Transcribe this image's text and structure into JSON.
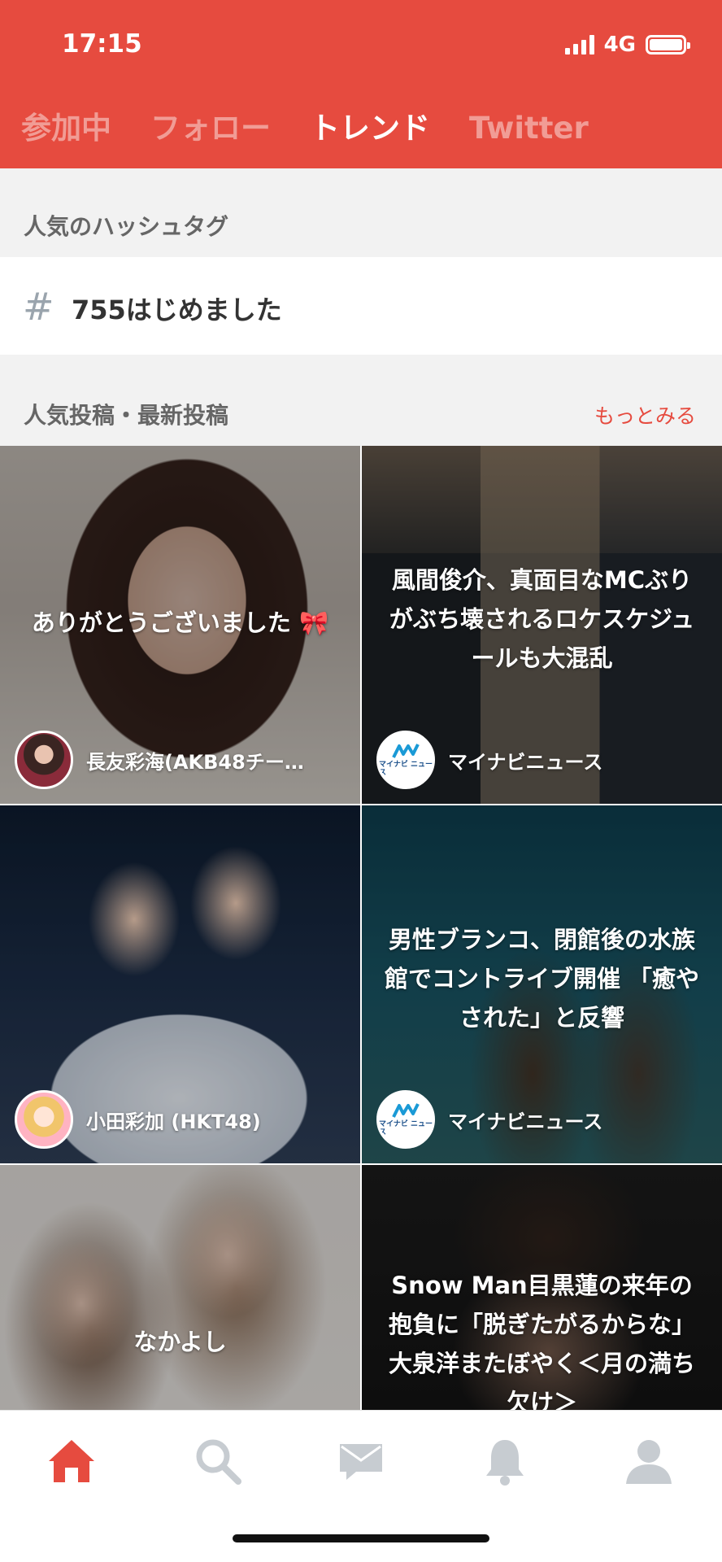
{
  "status_bar": {
    "time": "17:15",
    "network": "4G"
  },
  "tabs": [
    {
      "label": "参加中",
      "active": false
    },
    {
      "label": "フォロー",
      "active": false
    },
    {
      "label": "トレンド",
      "active": true
    },
    {
      "label": "Twitter",
      "active": false
    }
  ],
  "hashtags": {
    "title": "人気のハッシュタグ",
    "items": [
      {
        "icon": "hash-icon",
        "label": "755はじめました"
      }
    ]
  },
  "posts": {
    "title": "人気投稿・最新投稿",
    "more_label": "もっとみる",
    "cards": [
      {
        "text": "ありがとうございました 🎀",
        "source": "長友彩海(AKB48チー…",
        "avatar": "member-avatar"
      },
      {
        "text": "風間俊介、真面目なMCぶりがぶち壊されるロケスケジュールも大混乱",
        "source": "マイナビニュース",
        "avatar": "mynavi-logo"
      },
      {
        "text": "",
        "source": "小田彩加 (HKT48)",
        "avatar": "member-avatar"
      },
      {
        "text": "男性ブランコ、閉館後の水族館でコントライブ開催 「癒やされた」と反響",
        "source": "マイナビニュース",
        "avatar": "mynavi-logo"
      },
      {
        "text": "なかよし",
        "source": "",
        "avatar": ""
      },
      {
        "text": "Snow Man目黒蓮の来年の抱負に「脱ぎたがるからな」大泉洋またぼやく＜月の満ち欠け＞",
        "source": "",
        "avatar": ""
      }
    ]
  },
  "bottom_nav": [
    {
      "icon": "home-icon",
      "active": true
    },
    {
      "icon": "search-icon",
      "active": false
    },
    {
      "icon": "mail-icon",
      "active": false
    },
    {
      "icon": "bell-icon",
      "active": false
    },
    {
      "icon": "profile-icon",
      "active": false
    }
  ],
  "colors": {
    "accent": "#e64b3f",
    "inactive_icon": "#c7ccd1"
  },
  "logo_text": {
    "mynavi": "マイナビ ニュース"
  }
}
